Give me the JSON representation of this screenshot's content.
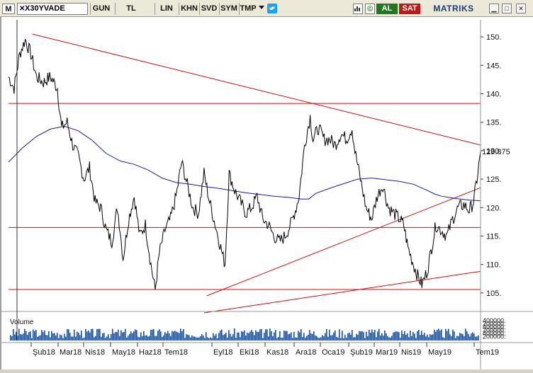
{
  "toolbar": {
    "m_label": "M",
    "symbol": "X30YVADE",
    "period": "GUN",
    "currency": "TL",
    "scale": "LIN",
    "btn_khn": "KHN",
    "btn_svd": "SVD",
    "btn_sym": "SYM",
    "btn_tmp": "TMP",
    "buy_label": "AL",
    "sell_label": "SAT",
    "brand": "MATRIKS",
    "brand_accent": "#c01818",
    "buy_color": "#1f7a1f",
    "sell_color": "#c01818",
    "icons": [
      "close-icon",
      "dropdown-arrow-icon",
      "twitter-icon",
      "chart-type-icon",
      "refresh-icon",
      "minimize-icon",
      "maximize-icon",
      "close-window-icon"
    ]
  },
  "chart_data": {
    "type": "line",
    "series": [],
    "price_axis": {
      "ticks": [
        150,
        145,
        140,
        135,
        130,
        125,
        120,
        115,
        110,
        105
      ],
      "tick_labels": [
        "150.",
        "145.",
        "140.",
        "135.",
        "130.",
        "125.",
        "120.",
        "115.",
        "110.",
        "105."
      ],
      "last_price": 129.875,
      "last_price_label": "129.875",
      "range": [
        102,
        153
      ]
    },
    "volume": {
      "title": "Volume",
      "axis_labels": [
        "400000.",
        "200000.",
        "400000.",
        "200000.",
        "400000.",
        "200000."
      ]
    },
    "x_axis_labels": [
      "Şub18",
      "Mar18",
      "Nis18",
      "May18",
      "Haz18",
      "Tem18",
      "Eyl18",
      "Eki18",
      "Kas18",
      "Ara18",
      "Oca19",
      "Şub19",
      "Mar19",
      "Nis19",
      "May19",
      "Tem19"
    ],
    "price_path": [
      [
        0,
        143
      ],
      [
        4,
        141
      ],
      [
        8,
        147
      ],
      [
        12,
        149.5
      ],
      [
        16,
        147
      ],
      [
        20,
        143
      ],
      [
        25,
        142
      ],
      [
        30,
        143
      ],
      [
        35,
        141
      ],
      [
        38,
        134
      ],
      [
        42,
        135
      ],
      [
        46,
        131
      ],
      [
        50,
        129
      ],
      [
        54,
        125
      ],
      [
        58,
        127
      ],
      [
        62,
        121
      ],
      [
        66,
        120
      ],
      [
        70,
        116
      ],
      [
        74,
        114
      ],
      [
        78,
        120
      ],
      [
        80,
        116
      ],
      [
        82,
        111
      ],
      [
        86,
        118
      ],
      [
        90,
        122
      ],
      [
        94,
        115
      ],
      [
        98,
        117
      ],
      [
        102,
        110
      ],
      [
        105,
        105.5
      ],
      [
        108,
        112
      ],
      [
        112,
        116
      ],
      [
        116,
        118
      ],
      [
        120,
        122
      ],
      [
        124,
        128
      ],
      [
        128,
        124
      ],
      [
        132,
        120
      ],
      [
        136,
        119
      ],
      [
        140,
        126
      ],
      [
        144,
        121
      ],
      [
        148,
        117
      ],
      [
        152,
        113
      ],
      [
        155,
        110
      ],
      [
        158,
        126
      ],
      [
        162,
        123
      ],
      [
        166,
        121
      ],
      [
        170,
        119
      ],
      [
        174,
        120
      ],
      [
        178,
        122
      ],
      [
        182,
        118
      ],
      [
        186,
        117
      ],
      [
        190,
        115
      ],
      [
        194,
        114
      ],
      [
        198,
        115
      ],
      [
        202,
        117
      ],
      [
        206,
        120
      ],
      [
        208,
        122
      ],
      [
        212,
        131
      ],
      [
        216,
        136
      ],
      [
        218,
        132
      ],
      [
        222,
        134
      ],
      [
        226,
        132
      ],
      [
        230,
        132
      ],
      [
        234,
        131
      ],
      [
        238,
        133
      ],
      [
        242,
        132
      ],
      [
        246,
        134
      ],
      [
        248,
        130
      ],
      [
        252,
        125
      ],
      [
        256,
        120
      ],
      [
        260,
        118
      ],
      [
        264,
        122
      ],
      [
        268,
        124
      ],
      [
        272,
        120
      ],
      [
        276,
        119
      ],
      [
        280,
        118
      ],
      [
        283,
        117
      ],
      [
        286,
        113
      ],
      [
        290,
        110
      ],
      [
        293,
        108
      ],
      [
        296,
        106.5
      ],
      [
        300,
        109
      ],
      [
        303,
        113
      ],
      [
        306,
        117
      ],
      [
        310,
        116
      ],
      [
        314,
        115
      ],
      [
        318,
        118
      ],
      [
        322,
        120
      ],
      [
        326,
        120.5
      ],
      [
        330,
        119.5
      ],
      [
        333,
        121
      ],
      [
        336,
        126
      ],
      [
        338,
        129.9
      ]
    ],
    "ma_path": [
      [
        0,
        128
      ],
      [
        10,
        130.5
      ],
      [
        20,
        132.5
      ],
      [
        30,
        133.8
      ],
      [
        40,
        134.3
      ],
      [
        50,
        133.5
      ],
      [
        60,
        131.8
      ],
      [
        70,
        129.5
      ],
      [
        80,
        128.2
      ],
      [
        90,
        127.6
      ],
      [
        100,
        126.6
      ],
      [
        110,
        125.2
      ],
      [
        120,
        124.4
      ],
      [
        130,
        124.1
      ],
      [
        140,
        123.7
      ],
      [
        150,
        123.4
      ],
      [
        160,
        123
      ],
      [
        170,
        122.6
      ],
      [
        180,
        122.3
      ],
      [
        190,
        122
      ],
      [
        200,
        121.8
      ],
      [
        210,
        121.5
      ],
      [
        215,
        121.5
      ],
      [
        220,
        122.5
      ],
      [
        230,
        123.4
      ],
      [
        240,
        124.2
      ],
      [
        250,
        125
      ],
      [
        260,
        125.2
      ],
      [
        270,
        124.9
      ],
      [
        280,
        124.6
      ],
      [
        290,
        124.1
      ],
      [
        300,
        123
      ],
      [
        305,
        122.4
      ],
      [
        310,
        122
      ],
      [
        320,
        121.6
      ],
      [
        330,
        121.3
      ],
      [
        338,
        121.2
      ]
    ],
    "lines": [
      {
        "name": "upper-trendline",
        "from": [
          17,
          150.5
        ],
        "to": [
          338,
          131
        ],
        "color": "#c81010"
      },
      {
        "name": "horizontal-138",
        "from": [
          0,
          138.3
        ],
        "to": [
          338,
          138.3
        ],
        "color": "#c81010"
      },
      {
        "name": "horizontal-116.5",
        "from": [
          0,
          116.5
        ],
        "to": [
          338,
          116.5
        ],
        "color": "#c81010"
      },
      {
        "name": "horizontal-105.6",
        "from": [
          0,
          105.6
        ],
        "to": [
          338,
          105.6
        ],
        "color": "#c81010"
      },
      {
        "name": "lower-trendline-rising",
        "from": [
          142,
          104.5
        ],
        "to": [
          338,
          123.5
        ],
        "color": "#c81010"
      },
      {
        "name": "lower-trendline-bottom",
        "from": [
          140,
          101.5
        ],
        "to": [
          338,
          108.8
        ],
        "color": "#c81010"
      }
    ],
    "grid": false,
    "colors": {
      "price": "#000000",
      "ma": "#1a1a9c",
      "volume": "#1f4f8f",
      "lines": "#c81010"
    }
  }
}
